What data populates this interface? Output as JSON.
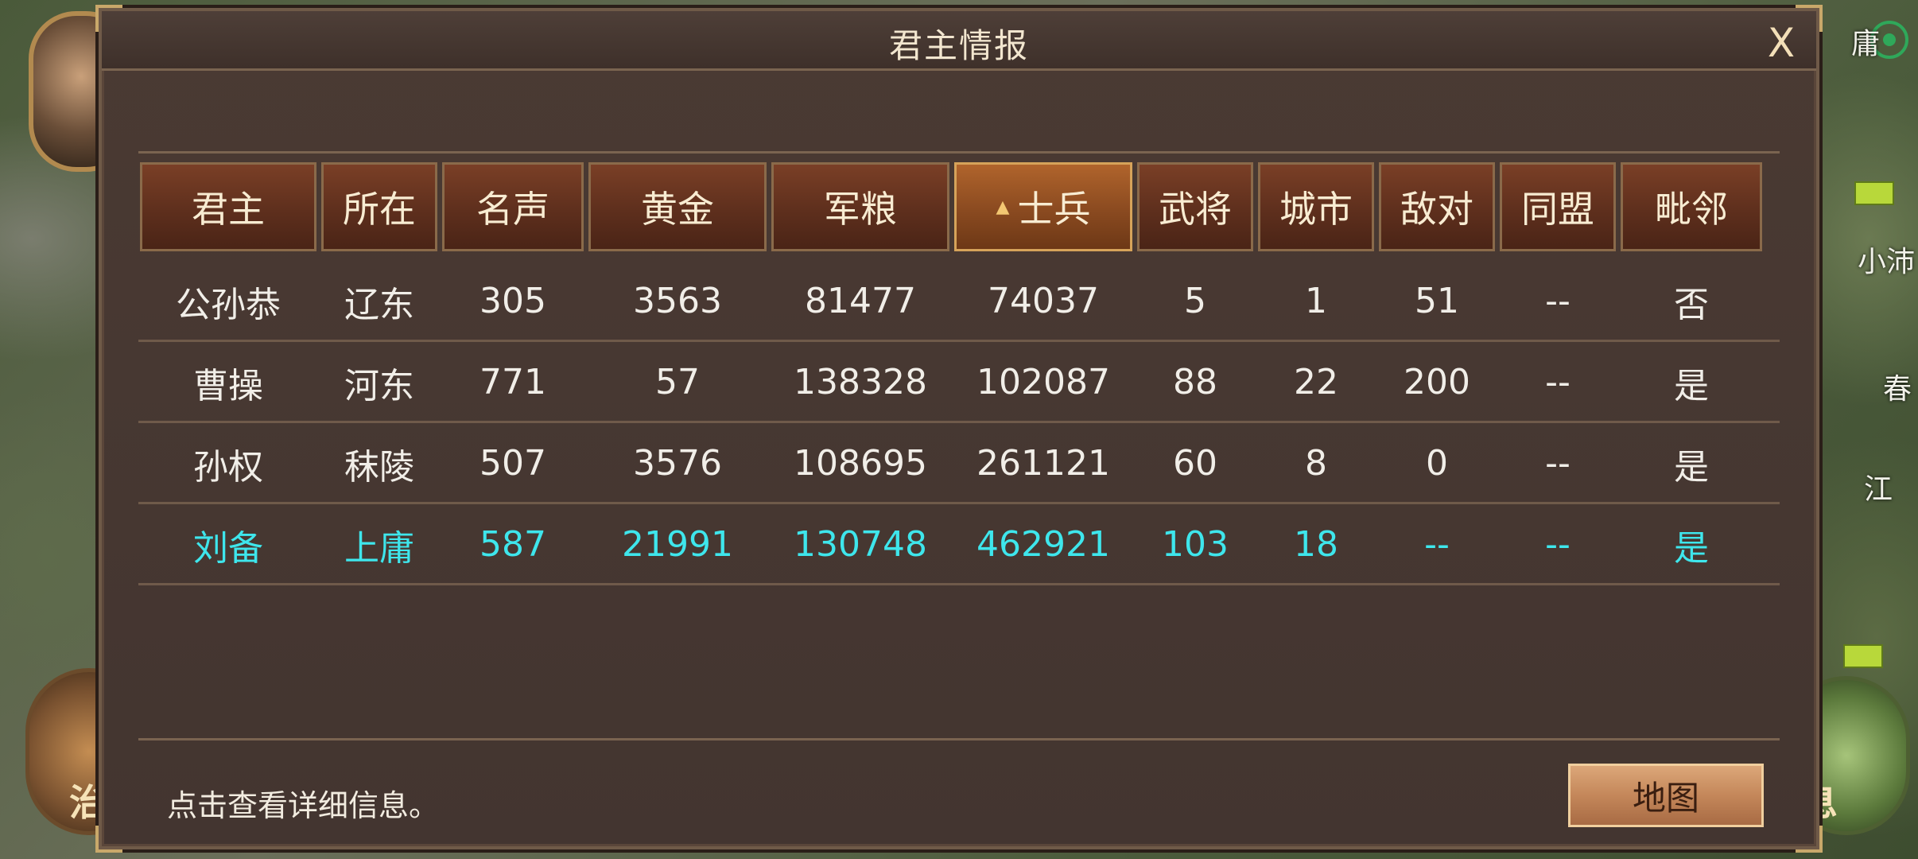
{
  "dialog": {
    "title": "君主情报",
    "close_label": "X",
    "hint": "点击查看详细信息。",
    "map_button": "地图"
  },
  "table": {
    "headers": [
      "君主",
      "所在",
      "名声",
      "黄金",
      "军粮",
      "士兵",
      "武将",
      "城市",
      "敌对",
      "同盟",
      "毗邻"
    ],
    "sorted_column": "士兵",
    "sort_arrow": "▲",
    "rows": [
      [
        "公孙恭",
        "辽东",
        "305",
        "3563",
        "81477",
        "74037",
        "5",
        "1",
        "51",
        "--",
        "否"
      ],
      [
        "曹操",
        "河东",
        "771",
        "57",
        "138328",
        "102087",
        "88",
        "22",
        "200",
        "--",
        "是"
      ],
      [
        "孙权",
        "秣陵",
        "507",
        "3576",
        "108695",
        "261121",
        "60",
        "8",
        "0",
        "--",
        "是"
      ],
      [
        "刘备",
        "上庸",
        "587",
        "21991",
        "130748",
        "462921",
        "103",
        "18",
        "--",
        "--",
        "是"
      ]
    ],
    "player_row_index": 3,
    "player_color": "#3ee6ec"
  },
  "map": {
    "right_labels": [
      "庸",
      "小沛",
      "春",
      "江"
    ],
    "left_button_glyph": "治",
    "right_button_glyph": "息"
  }
}
